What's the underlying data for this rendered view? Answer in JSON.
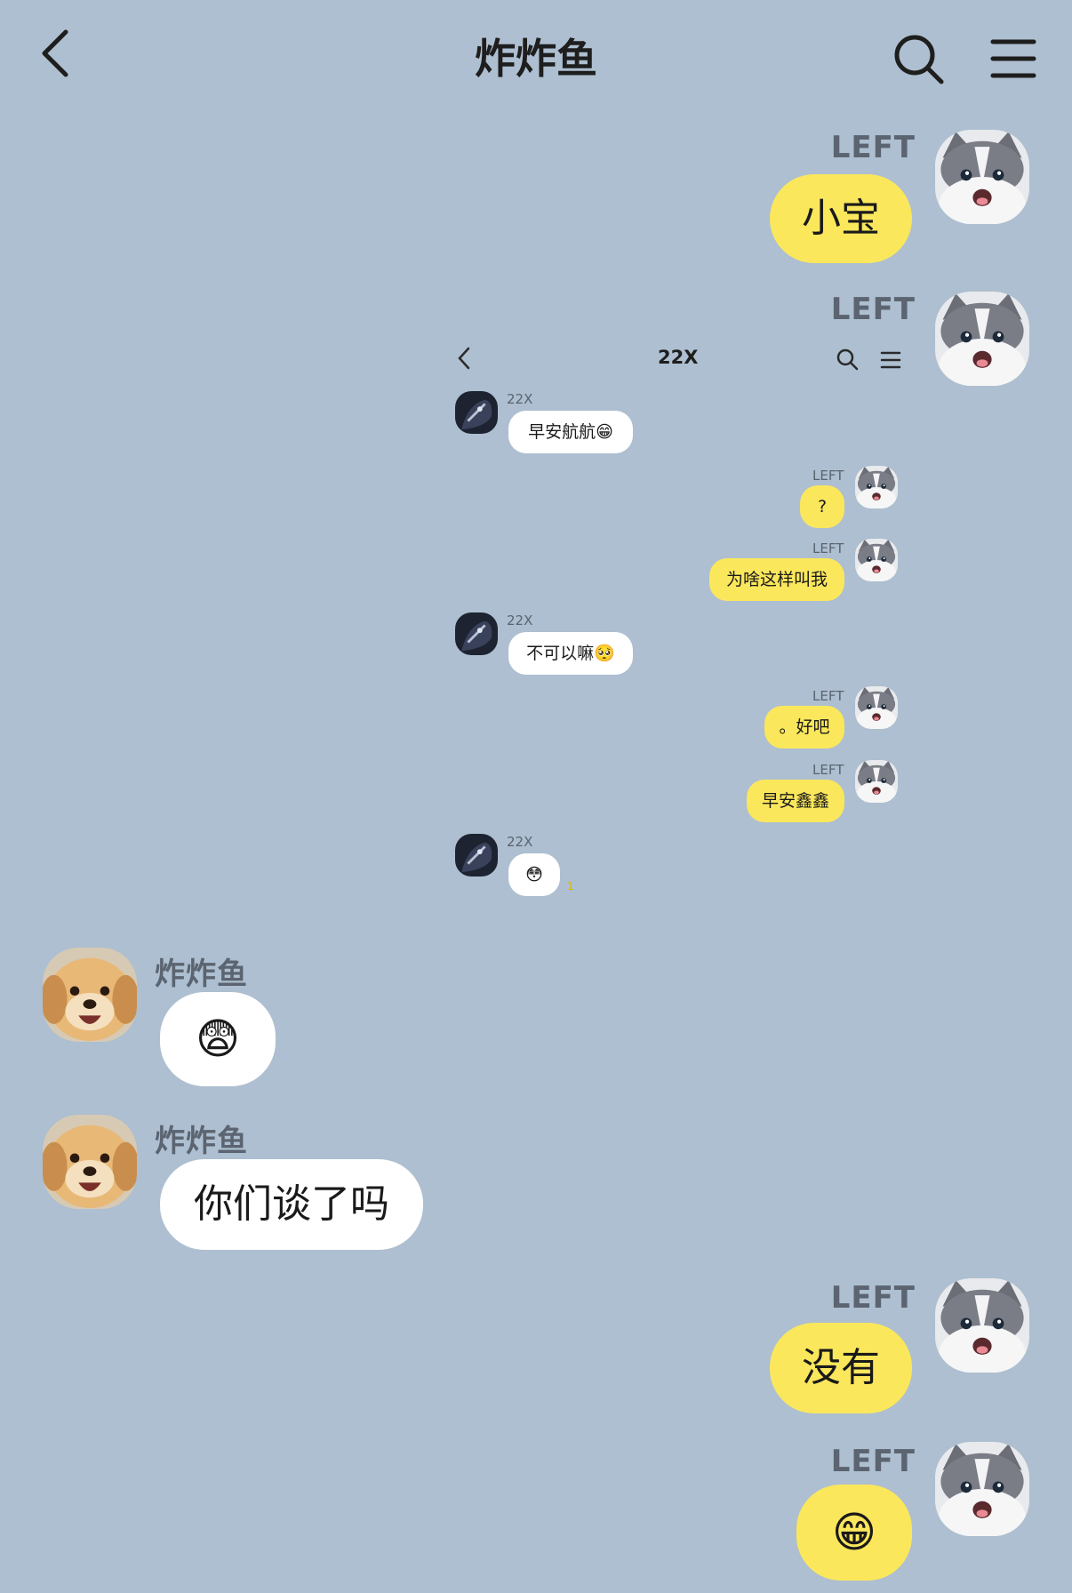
{
  "header": {
    "title": "炸炸鱼",
    "back_icon": "chevron-left-icon",
    "search_icon": "search-icon",
    "menu_icon": "hamburger-menu-icon"
  },
  "messages": [
    {
      "sender": "LEFT",
      "text": "小宝",
      "side": "right"
    },
    {
      "sender": "LEFT",
      "type": "screenshot",
      "side": "right"
    },
    {
      "sender": "炸炸鱼",
      "text": "😨",
      "side": "left"
    },
    {
      "sender": "炸炸鱼",
      "text": "你们谈了吗",
      "side": "left"
    },
    {
      "sender": "LEFT",
      "text": "没有",
      "side": "right"
    },
    {
      "sender": "LEFT",
      "text": "😁",
      "side": "right"
    }
  ],
  "screenshot": {
    "title": "22X",
    "messages": [
      {
        "sender": "22X",
        "text": "早安航航😁",
        "side": "left"
      },
      {
        "sender": "LEFT",
        "text": "?",
        "side": "right"
      },
      {
        "sender": "LEFT",
        "text": "为啥这样叫我",
        "side": "right"
      },
      {
        "sender": "22X",
        "text": "不可以嘛🥺",
        "side": "left"
      },
      {
        "sender": "LEFT",
        "text": "。好吧",
        "side": "right"
      },
      {
        "sender": "LEFT",
        "text": "早安鑫鑫",
        "side": "right"
      },
      {
        "sender": "22X",
        "text": "😳",
        "side": "left",
        "unread": "1"
      }
    ]
  },
  "colors": {
    "background": "#adbfd0",
    "my_bubble": "#fbe75c",
    "their_bubble": "#ffffff"
  }
}
